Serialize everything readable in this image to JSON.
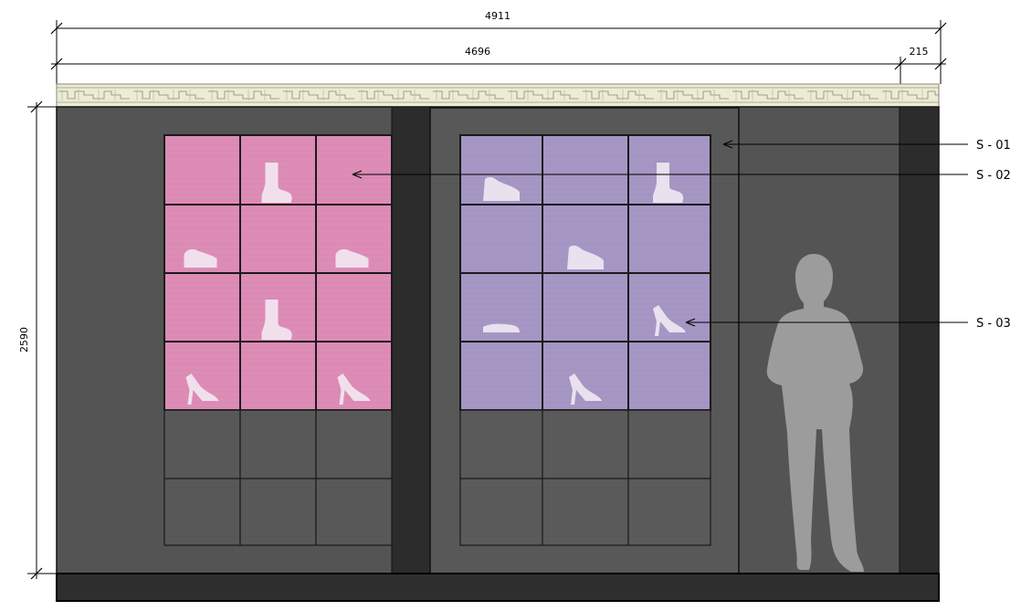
{
  "dimensions": {
    "overall_width": "4911",
    "main_width": "4696",
    "side_width": "215",
    "height": "2590"
  },
  "callouts": [
    {
      "label": "S - 01",
      "target": "left-edge-of-right-cabinet-panel"
    },
    {
      "label": "S - 02",
      "target": "left-shelf-display-cell"
    },
    {
      "label": "S - 03",
      "target": "right-shelf-heel-display"
    }
  ],
  "colors": {
    "wall": "#545454",
    "pilaster": "#2c2c2c",
    "plinth": "#2e2e2e",
    "cabinet_panel": "#585858",
    "left_display_fill": "#dd8cb6",
    "right_display_fill": "#a696c4",
    "cornice": "#ececd6",
    "figure": "#9c9c9c",
    "shoe": "#f5eef6"
  },
  "display_items": {
    "left_display": [
      "empty",
      "boot",
      "empty",
      "loafer",
      "empty",
      "loafer",
      "empty",
      "boot",
      "empty",
      "heel",
      "empty",
      "heel"
    ],
    "right_display": [
      "sneaker",
      "empty",
      "boot",
      "empty",
      "sneaker",
      "empty",
      "sandal",
      "empty",
      "heel",
      "empty",
      "heel",
      "empty"
    ]
  }
}
